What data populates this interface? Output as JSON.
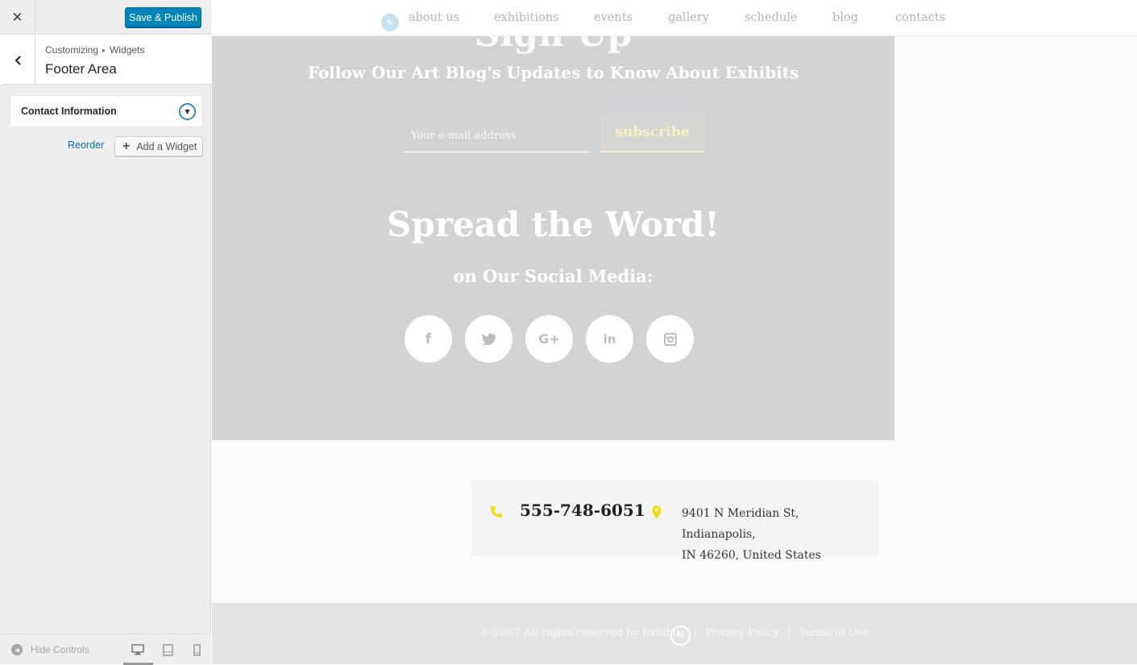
{
  "colors": {
    "primary_button": "#0085ba",
    "link": "#0073aa",
    "hero_background": "#d2d3d5",
    "accent_yellow": "#f5d90a"
  },
  "customizer": {
    "close_icon": "close-icon",
    "save_publish_label": "Save & Publish",
    "breadcrumb": {
      "root": "Customizing",
      "separator": "▸",
      "current": "Widgets"
    },
    "section_title": "Footer Area",
    "widget": {
      "title": "Contact Information",
      "toggle_icon": "arrow-down-icon"
    },
    "reorder_label": "Reorder",
    "add_widget_label": "Add a Widget",
    "footer": {
      "hide_controls_label": "Hide Controls",
      "devices": [
        "desktop-icon",
        "tablet-icon",
        "mobile-icon"
      ],
      "active_device": "desktop"
    }
  },
  "preview": {
    "nav": {
      "items": [
        "about us",
        "exhibitions",
        "events",
        "gallery",
        "schedule",
        "blog",
        "contacts"
      ]
    },
    "signup": {
      "heading_fragment": "Sign Up",
      "subheading": "Follow Our Art Blog's Updates to Know About Exhibits",
      "email_placeholder": "Your e-mail address",
      "subscribe_label": "subscribe"
    },
    "spread": {
      "title": "Spread the Word!",
      "subtitle": "on Our Social Media:",
      "social_icons": [
        "facebook-icon",
        "twitter-icon",
        "google-plus-icon",
        "linkedin-icon",
        "instagram-icon"
      ],
      "social_glyphs": [
        "f",
        "t",
        "G+",
        "in",
        "◻"
      ]
    },
    "contact": {
      "phone": "555-748-6051",
      "address_line1": "9401 N Meridian St, Indianapolis,",
      "address_line2": "IN 46260, United States"
    },
    "footer": {
      "copyright": "© 2017 All rights reserved by Exhibits",
      "privacy": "Privacy Policy",
      "terms": "Terms of Use",
      "separator": "|"
    }
  }
}
